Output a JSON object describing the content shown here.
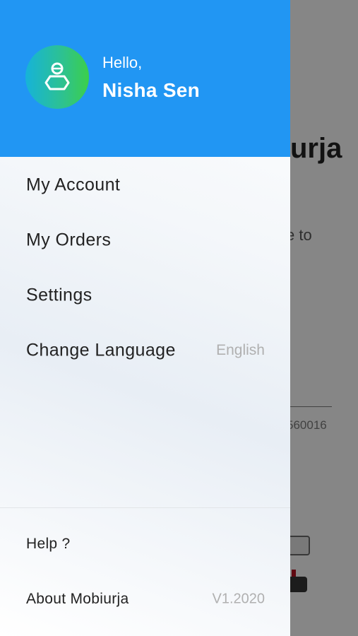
{
  "background_app": {
    "title_fragment": "urja",
    "text_fragment": "e to",
    "pincode_fragment": "560016"
  },
  "drawer": {
    "greeting": "Hello,",
    "user_name": "Nisha Sen",
    "avatar_icon": "user-icon",
    "header_color": "#2196f3",
    "menu": [
      {
        "label": "My Account",
        "value": ""
      },
      {
        "label": "My Orders",
        "value": ""
      },
      {
        "label": "Settings",
        "value": ""
      },
      {
        "label": "Change Language",
        "value": "English"
      }
    ],
    "footer": [
      {
        "label": "Help ?",
        "value": ""
      },
      {
        "label": "About Mobiurja",
        "value": "V1.2020"
      }
    ]
  }
}
